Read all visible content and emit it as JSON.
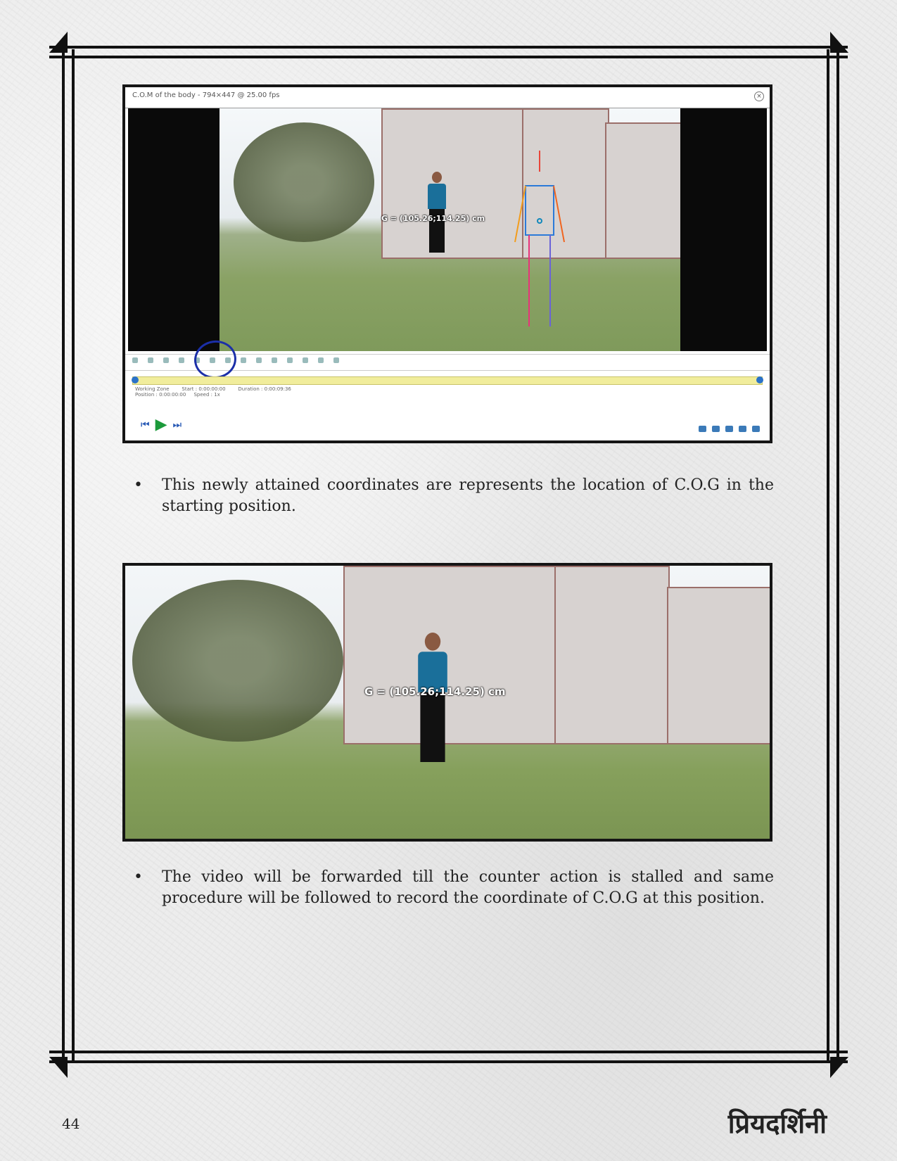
{
  "player": {
    "title": "C.O.M of the body - 794×447 @ 25.00 fps",
    "cog_label": "G = (105.26;114.25) cm",
    "working_zone": "Working Zone",
    "start": "Start : 0:00:00:00",
    "duration": "Duration : 0:00:09:36",
    "position": "Position : 0:00:00:00",
    "speed": "Speed : 1x"
  },
  "bullets": [
    "This newly attained coordinates are represents the location of C.O.G in the starting position.",
    "The video will be forwarded till the counter action is stalled and same procedure will be followed to record the coordinate of C.O.G at this position."
  ],
  "frame2": {
    "cog_label": "G = (105.26;114.25) cm"
  },
  "footer": {
    "page_number": "44",
    "brand": "प्रियदर्शिनी"
  }
}
